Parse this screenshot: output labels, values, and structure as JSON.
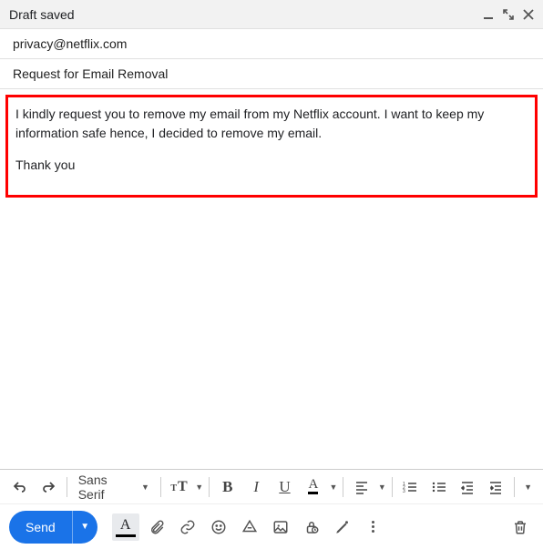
{
  "header": {
    "title": "Draft saved"
  },
  "recipients": "privacy@netflix.com",
  "subject": "Request for Email Removal",
  "body": {
    "para1": "I kindly request you to remove my email from my Netflix account. I want to keep my information safe hence, I decided to remove my email.",
    "para2": "Thank you"
  },
  "toolbar": {
    "font": "Sans Serif",
    "send_label": "Send"
  }
}
